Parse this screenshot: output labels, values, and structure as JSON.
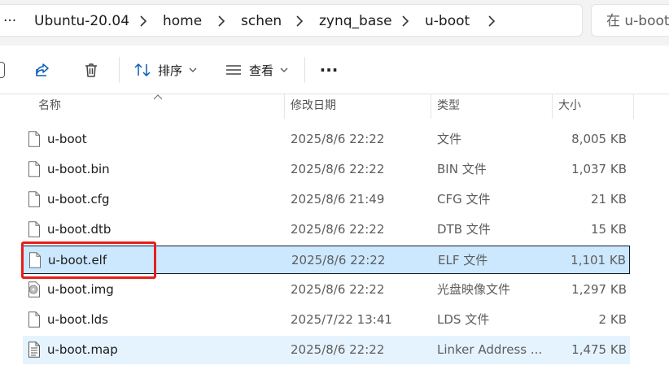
{
  "breadcrumb": {
    "overflow": "···",
    "items": [
      "Ubuntu-20.04",
      "home",
      "schen",
      "zynq_base",
      "u-boot"
    ],
    "search_placeholder": "在 u-boot"
  },
  "toolbar": {
    "sort_label": "排序",
    "view_label": "查看",
    "more_label": "···"
  },
  "columns": {
    "name": "名称",
    "date": "修改日期",
    "type": "类型",
    "size": "大小"
  },
  "files": [
    {
      "name": "u-boot",
      "date": "2025/8/6 22:22",
      "type": "文件",
      "size": "8,005 KB",
      "icon": "file-icon"
    },
    {
      "name": "u-boot.bin",
      "date": "2025/8/6 22:22",
      "type": "BIN 文件",
      "size": "1,037 KB",
      "icon": "file-icon"
    },
    {
      "name": "u-boot.cfg",
      "date": "2025/8/6 21:49",
      "type": "CFG 文件",
      "size": "21 KB",
      "icon": "file-icon"
    },
    {
      "name": "u-boot.dtb",
      "date": "2025/8/6 22:22",
      "type": "DTB 文件",
      "size": "15 KB",
      "icon": "file-icon"
    },
    {
      "name": "u-boot.elf",
      "date": "2025/8/6 22:22",
      "type": "ELF 文件",
      "size": "1,101 KB",
      "icon": "file-icon",
      "state": "selected"
    },
    {
      "name": "u-boot.img",
      "date": "2025/8/6 22:22",
      "type": "光盘映像文件",
      "size": "1,297 KB",
      "icon": "disc-image-icon"
    },
    {
      "name": "u-boot.lds",
      "date": "2025/7/22 13:41",
      "type": "LDS 文件",
      "size": "2 KB",
      "icon": "file-icon"
    },
    {
      "name": "u-boot.map",
      "date": "2025/8/6 22:22",
      "type": "Linker Address ...",
      "size": "1,475 KB",
      "icon": "text-file-icon",
      "state": "hover"
    }
  ],
  "colors": {
    "selection_bg": "#cce8ff",
    "hover_bg": "#e5f3ff",
    "highlight_box": "#e3201c",
    "accent_blue": "#0a5fb4"
  }
}
